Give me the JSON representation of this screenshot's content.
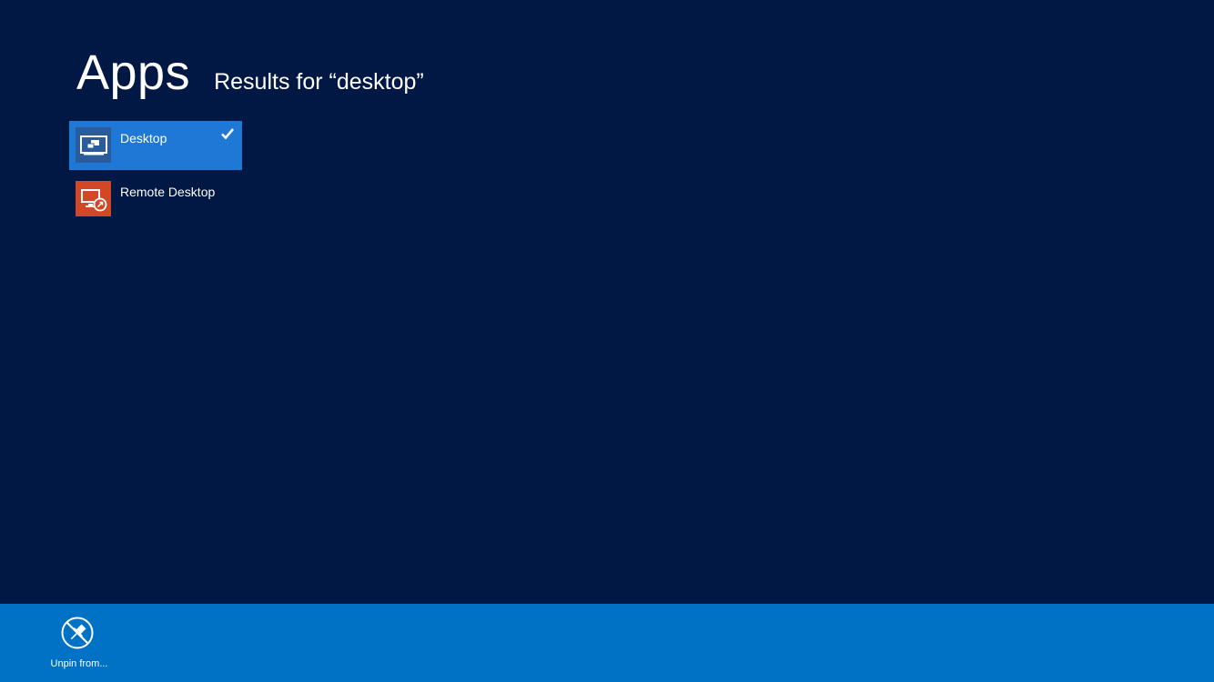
{
  "header": {
    "title": "Apps",
    "results_text": "Results for “desktop”"
  },
  "apps": [
    {
      "label": "Desktop",
      "icon": "desktop-icon",
      "selected": true
    },
    {
      "label": "Remote Desktop",
      "icon": "remote-desktop-icon",
      "selected": false
    }
  ],
  "app_bar": {
    "unpin_label": "Unpin from...",
    "unpin_icon": "unpin-icon"
  },
  "colors": {
    "background": "#001843",
    "selection": "#1f78d6",
    "app_bar": "#0072c6",
    "desktop_tile": "#2a5c9c",
    "remote_tile": "#d24726"
  }
}
